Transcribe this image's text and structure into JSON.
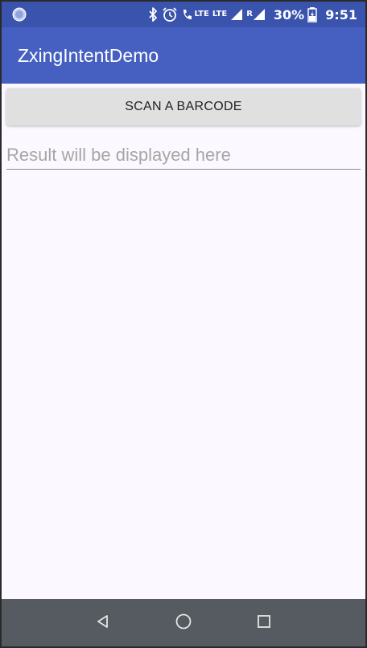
{
  "status_bar": {
    "lte_label_1": "LTE",
    "lte_label_2": "LTE",
    "roaming_label": "R",
    "battery_percent": "30%",
    "time": "9:51",
    "icon_color": "#ffffff",
    "background": "#3a53ad"
  },
  "app_bar": {
    "title": "ZxingIntentDemo",
    "background": "#4560c1"
  },
  "main": {
    "scan_button_label": "SCAN A BARCODE",
    "result_placeholder": "Result will be displayed here",
    "result_value": ""
  },
  "nav_bar": {
    "back_icon": "back-triangle-icon",
    "home_icon": "home-circle-icon",
    "recents_icon": "recents-square-icon",
    "background": "#555b60"
  }
}
